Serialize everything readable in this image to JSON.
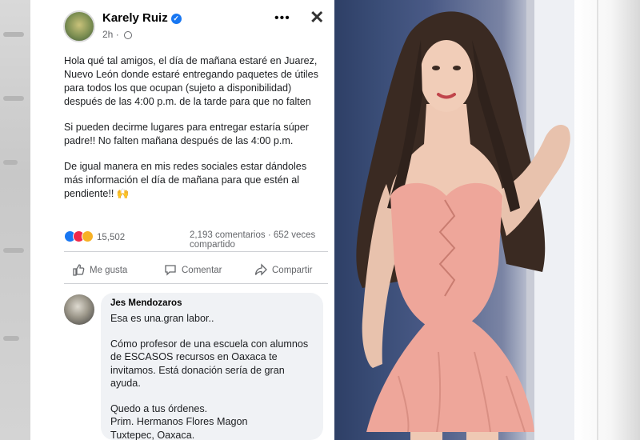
{
  "post": {
    "author": "Karely Ruiz",
    "time": "2h",
    "more_label": "•••",
    "close_label": "✕",
    "paragraphs": [
      "Hola qué tal amigos, el día de mañana estaré en Juarez, Nuevo León donde estaré entregando paquetes de útiles para todos los que ocupan (sujeto a disponibilidad) después de las 4:00 p.m. de la tarde para que no falten",
      "Si pueden decirme lugares para entregar estaría súper padre!! No falten mañana después de las 4:00 p.m.",
      "De igual manera en mis redes sociales estar dándoles más información el día de mañana para que estén al pendiente!! 🙌"
    ],
    "reactions_count": "15,502",
    "comments_count": "2,193 comentarios",
    "shares_count": "652 veces compartido",
    "actions": {
      "like": "Me gusta",
      "comment": "Comentar",
      "share": "Compartir"
    }
  },
  "comment": {
    "author": "Jes Mendozaros",
    "paragraphs": [
      "Esa es una.gran labor..",
      "Cómo profesor de una escuela con alumnos de ESCASOS recursos en Oaxaca te invitamos. Está donación sería de gran ayuda.",
      "Quedo a tus órdenes.\nPrim. Hermanos Flores Magon\nTuxtepec, Oaxaca."
    ]
  },
  "colors": {
    "facebook_blue": "#1877f2",
    "love_red": "#f0284a",
    "secondary_text": "#65676b",
    "dress_pink": "#eea69a"
  },
  "icons": [
    "verified-badge-icon",
    "globe-icon",
    "more-icon",
    "close-icon",
    "like-icon",
    "comment-icon",
    "share-icon"
  ]
}
